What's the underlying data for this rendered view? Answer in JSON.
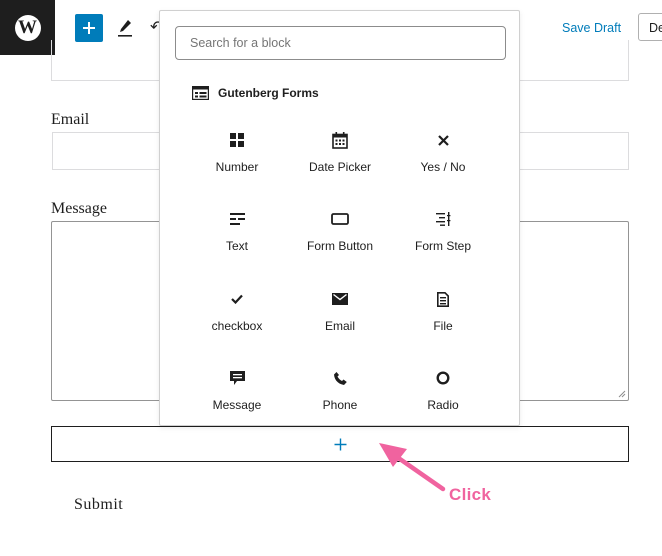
{
  "topbar": {
    "save_draft": "Save Draft",
    "preview_label": "De"
  },
  "form": {
    "email_label": "Email",
    "message_label": "Message",
    "submit_label": "Submit",
    "appender_icon": "plus-icon"
  },
  "inserter": {
    "search_placeholder": "Search for a block",
    "category": "Gutenberg Forms",
    "blocks": [
      {
        "label": "Number",
        "icon": "grid-icon"
      },
      {
        "label": "Date Picker",
        "icon": "calendar-icon"
      },
      {
        "label": "Yes / No",
        "icon": "close-icon"
      },
      {
        "label": "Text",
        "icon": "text-lines-icon"
      },
      {
        "label": "Form Button",
        "icon": "button-icon"
      },
      {
        "label": "Form Step",
        "icon": "steps-icon"
      },
      {
        "label": "checkbox",
        "icon": "check-icon"
      },
      {
        "label": "Email",
        "icon": "envelope-icon"
      },
      {
        "label": "File",
        "icon": "file-icon"
      },
      {
        "label": "Message",
        "icon": "comment-icon"
      },
      {
        "label": "Phone",
        "icon": "phone-icon"
      },
      {
        "label": "Radio",
        "icon": "circle-icon"
      }
    ]
  },
  "annotation": {
    "text": "Click",
    "color": "#f0639f"
  },
  "colors": {
    "accent": "#007cba",
    "dark": "#1e1e1e"
  }
}
